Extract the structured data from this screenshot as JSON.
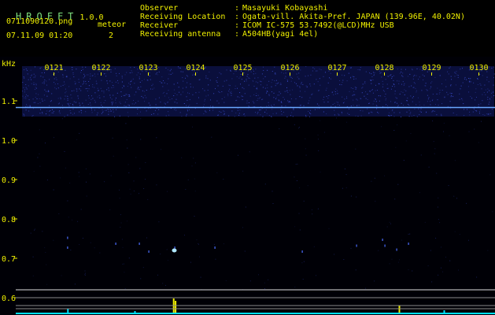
{
  "app": {
    "title": "HROFFT",
    "version": "1.0.0"
  },
  "file": {
    "name": "0711090120.png",
    "datetime": "07.11.09 01:20"
  },
  "counter": {
    "label": "meteor",
    "value": "2"
  },
  "info": [
    {
      "key": "Observer",
      "value": "Masayuki Kobayashi"
    },
    {
      "key": "Receiving Location",
      "value": "Ogata-vill. Akita-Pref. JAPAN (139.96E, 40.02N)"
    },
    {
      "key": "Receiver",
      "value": "ICOM IC-575 53.7492(@LCD)MHz USB"
    },
    {
      "key": "Receiving antenna",
      "value": "A504HB(yagi 4el)"
    }
  ],
  "colors": {
    "text": "#f0f000",
    "title": "#7ee07e",
    "signal": "#00e0ff",
    "carrier": "#6aa8ff",
    "noise": "#3a4cc8",
    "grid": "#ffffff"
  },
  "chart_data": {
    "type": "heatmap",
    "ylabel": "kHz",
    "time_ticks": [
      "0121",
      "0122",
      "0123",
      "0124",
      "0125",
      "0126",
      "0127",
      "0128",
      "0129",
      "0130"
    ],
    "freq_ticks": [
      {
        "label": "1.1",
        "value": 1.1
      },
      {
        "label": "1.0",
        "value": 1.0
      },
      {
        "label": "0.9",
        "value": 0.9
      },
      {
        "label": "0.8",
        "value": 0.8
      },
      {
        "label": "0.7",
        "value": 0.7
      },
      {
        "label": "0.6",
        "value": 0.6
      }
    ],
    "ylim": [
      0.58,
      1.2
    ],
    "carrier_khz": 1.083,
    "noise_band_khz": [
      1.06,
      1.2
    ],
    "echoes": [
      {
        "minute": 1.28,
        "khz": 0.755
      },
      {
        "minute": 1.28,
        "khz": 0.73
      },
      {
        "minute": 2.3,
        "khz": 0.74
      },
      {
        "minute": 2.8,
        "khz": 0.74
      },
      {
        "minute": 3.0,
        "khz": 0.72
      },
      {
        "minute": 3.55,
        "khz": 0.73
      },
      {
        "minute": 4.4,
        "khz": 0.73
      },
      {
        "minute": 6.25,
        "khz": 0.72
      },
      {
        "minute": 7.4,
        "khz": 0.735
      },
      {
        "minute": 7.95,
        "khz": 0.75
      },
      {
        "minute": 8.0,
        "khz": 0.735
      },
      {
        "minute": 8.25,
        "khz": 0.725
      },
      {
        "minute": 8.5,
        "khz": 0.74
      }
    ],
    "meteor_echo": {
      "minute": 3.55,
      "khz": 0.72
    },
    "activity_bars": [
      {
        "minute": 1.28,
        "level": 0.35,
        "color": "#00e0ff"
      },
      {
        "minute": 2.7,
        "level": 0.2,
        "color": "#00e0ff"
      },
      {
        "minute": 3.52,
        "level": 1.0,
        "color": "#f0f000"
      },
      {
        "minute": 3.56,
        "level": 0.85,
        "color": "#f0f000"
      },
      {
        "minute": 8.3,
        "level": 0.55,
        "color": "#f0f000"
      },
      {
        "minute": 9.25,
        "level": 0.25,
        "color": "#00e0ff"
      }
    ]
  }
}
